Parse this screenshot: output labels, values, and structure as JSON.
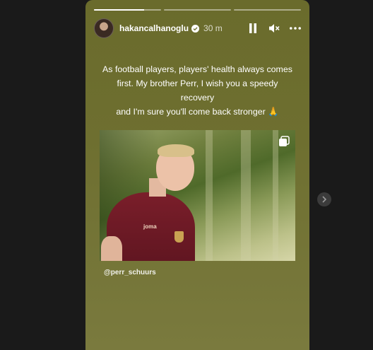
{
  "story": {
    "progress": [
      1,
      0,
      0
    ],
    "progress_filled_fraction": 0.75,
    "user": {
      "username": "hakancalhanoglu",
      "time_ago": "30 m",
      "verified": true
    },
    "controls": [
      "pause-icon",
      "mute-icon",
      "more-icon"
    ],
    "caption_lines": [
      "As football players, players' health always comes",
      "first. My brother Perr, I wish you a speedy recovery",
      "and I'm sure you'll come back stronger 🙏"
    ],
    "photo": {
      "sponsor": "joma",
      "icon": "multiple-images-icon"
    },
    "mention": "@perr_schuurs"
  },
  "navigation": {
    "next_icon": "chevron-right-icon"
  },
  "colors": {
    "story_background": "#6e6f30",
    "jersey": "#7a1e2a"
  }
}
